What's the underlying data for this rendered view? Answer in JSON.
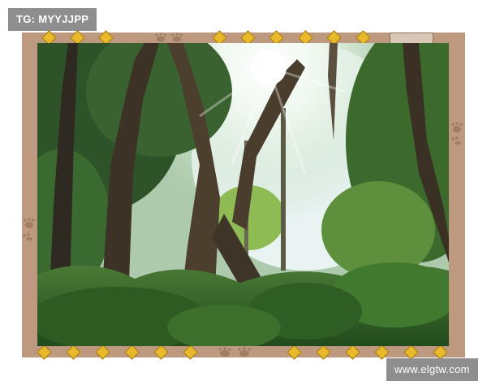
{
  "watermark_top_left": "TG: MYYJJPP",
  "watermark_bottom_right": "www.elgtw.com",
  "frame": {
    "color": "#bd9a7f",
    "ornament_icon": "diamond-icon",
    "paw_icon": "paw-print-icon",
    "ornament_color": "#e8b92a"
  },
  "photo": {
    "subject_icon": "forest-photo",
    "colors": {
      "sky": "#dfeef2",
      "foliage": "#3f6b2d",
      "undergrowth": "#2f5a25",
      "trunk": "#4a3a2b"
    }
  }
}
